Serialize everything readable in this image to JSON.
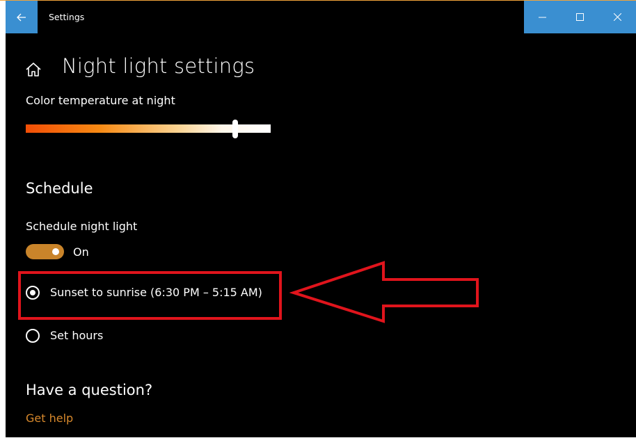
{
  "window": {
    "title": "Settings",
    "accent_color": "#3a8fd1",
    "back_icon": "arrow-left-icon",
    "minimize_icon": "minimize-icon",
    "maximize_icon": "maximize-icon",
    "close_icon": "close-icon"
  },
  "page": {
    "home_icon": "home-icon",
    "title": "Night light settings"
  },
  "color_temperature": {
    "label": "Color temperature at night",
    "slider_level": 0.85
  },
  "schedule": {
    "heading": "Schedule",
    "toggle_label": "Schedule night light",
    "toggle_state_text": "On",
    "toggle_on": true,
    "options": [
      {
        "label": "Sunset to sunrise (6:30 PM – 5:15 AM)",
        "selected": true
      },
      {
        "label": "Set hours",
        "selected": false
      }
    ]
  },
  "help": {
    "heading": "Have a question?",
    "link": "Get help",
    "link_color": "#d8892c"
  },
  "annotation": {
    "box_color": "#e0141c"
  }
}
